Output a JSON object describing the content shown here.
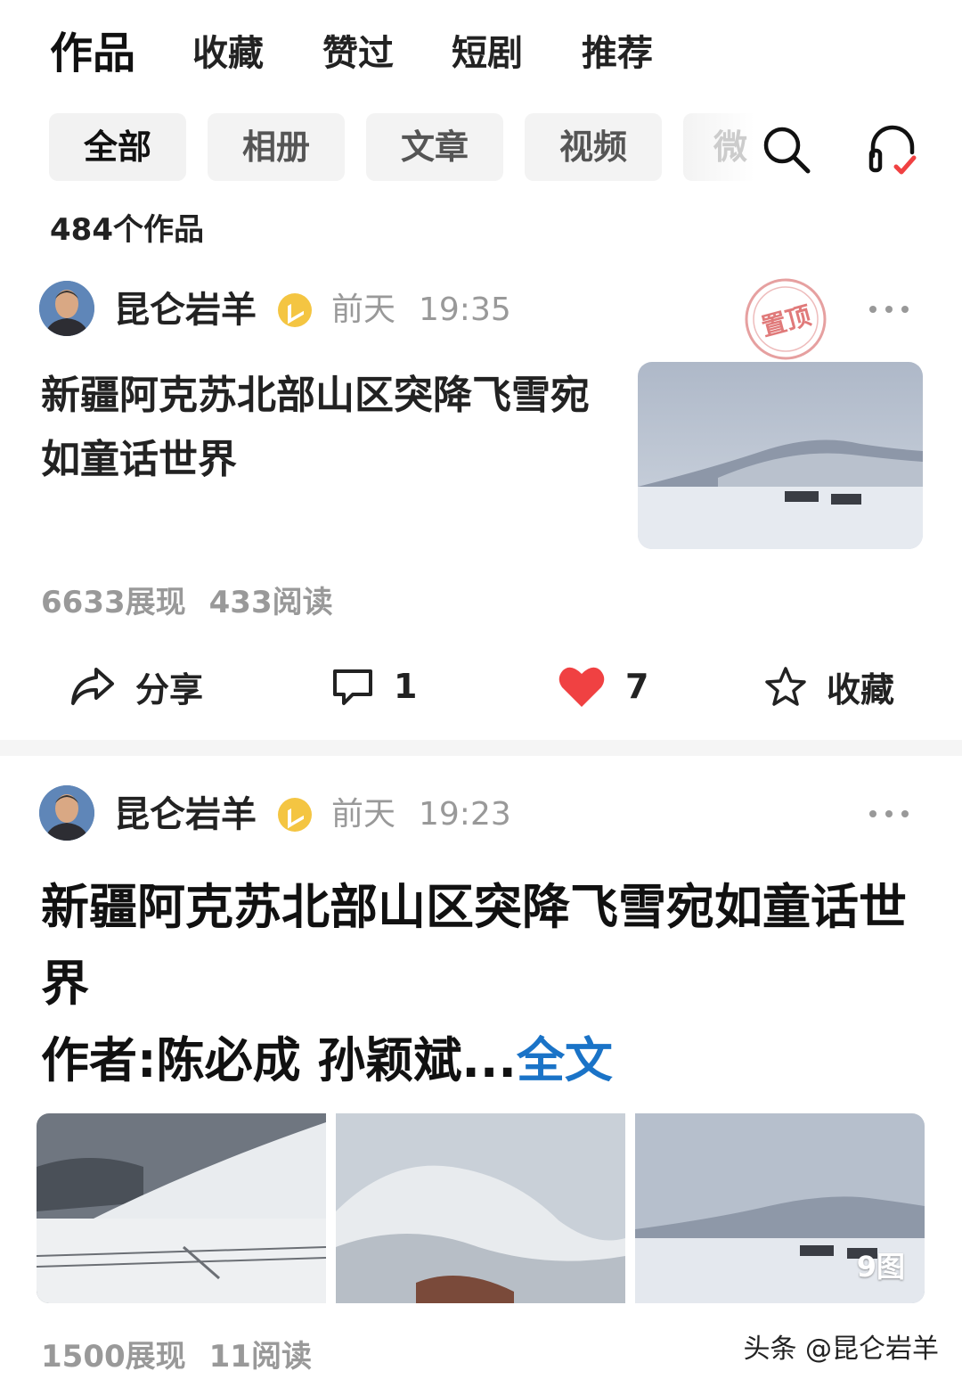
{
  "top_tabs": [
    "作品",
    "收藏",
    "赞过",
    "短剧",
    "推荐"
  ],
  "filters": [
    "全部",
    "相册",
    "文章",
    "视频",
    "微"
  ],
  "works_count": "484个作品",
  "post1": {
    "author": "昆仑岩羊",
    "day": "前天",
    "time": "19:35",
    "pinned": "置顶",
    "title": "新疆阿克苏北部山区突降飞雪宛如童话世界",
    "impressions": "6633展现",
    "reads": "433阅读",
    "share_label": "分享",
    "comments": "1",
    "likes": "7",
    "favorite_label": "收藏"
  },
  "post2": {
    "author": "昆仑岩羊",
    "day": "前天",
    "time": "19:23",
    "title_line": "新疆阿克苏北部山区突降飞雪宛如童话世界",
    "author_line": "作者:陈必成  孙颖斌...",
    "full_text_link": "全文",
    "image_count": "9图",
    "impressions": "1500展现",
    "reads": "11阅读"
  },
  "watermark": "头条 @昆仑岩羊",
  "colors": {
    "like": "#f04142",
    "link": "#1a73c7",
    "verified": "#f4c542",
    "stamp": "#e07a7a"
  }
}
